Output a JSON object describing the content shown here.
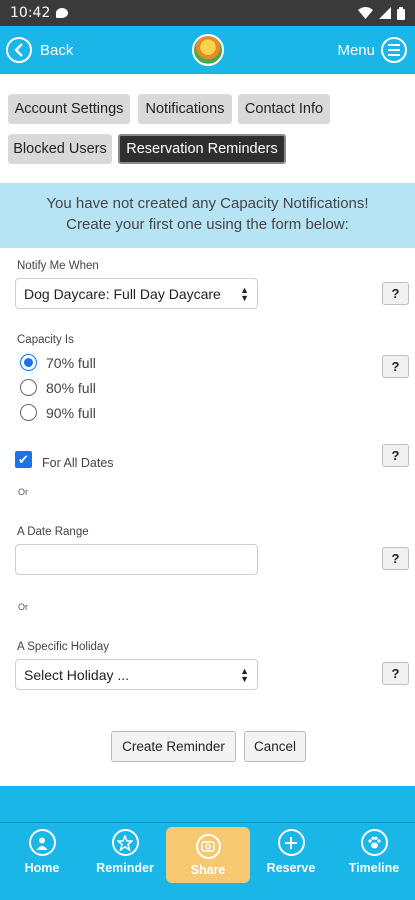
{
  "status_bar": {
    "time": "10:42"
  },
  "header": {
    "back_label": "Back",
    "menu_label": "Menu"
  },
  "tabs": [
    {
      "label": "Account Settings",
      "active": false
    },
    {
      "label": "Notifications",
      "active": false
    },
    {
      "label": "Contact Info",
      "active": false
    },
    {
      "label": "Blocked Users",
      "active": false
    },
    {
      "label": "Reservation Reminders",
      "active": true
    }
  ],
  "banner": {
    "line1": "You have not created any Capacity Notifications!",
    "line2": "Create your first one using the form below:"
  },
  "form": {
    "notify_label": "Notify Me When",
    "notify_value": "Dog Daycare: Full Day Daycare",
    "capacity_label": "Capacity Is",
    "capacity_options": [
      "70% full",
      "80% full",
      "90% full"
    ],
    "capacity_selected": "70% full",
    "all_dates_label": "For All Dates",
    "all_dates_checked": true,
    "or_text": "Or",
    "date_range_label": "A Date Range",
    "date_range_value": "",
    "holiday_label": "A Specific Holiday",
    "holiday_value": "Select Holiday ...",
    "help_label": "?",
    "create_label": "Create Reminder",
    "cancel_label": "Cancel"
  },
  "bottom_nav": [
    {
      "label": "Home",
      "icon": "home-icon"
    },
    {
      "label": "Reminder",
      "icon": "star-icon"
    },
    {
      "label": "Share",
      "icon": "camera-icon"
    },
    {
      "label": "Reserve",
      "icon": "plus-icon"
    },
    {
      "label": "Timeline",
      "icon": "paw-icon"
    }
  ],
  "colors": {
    "brand": "#1ab6e8",
    "banner": "#b7e4f5",
    "share_highlight": "#f7c872",
    "active_tab": "#2f2f2f",
    "control_accent": "#1a73e8"
  }
}
